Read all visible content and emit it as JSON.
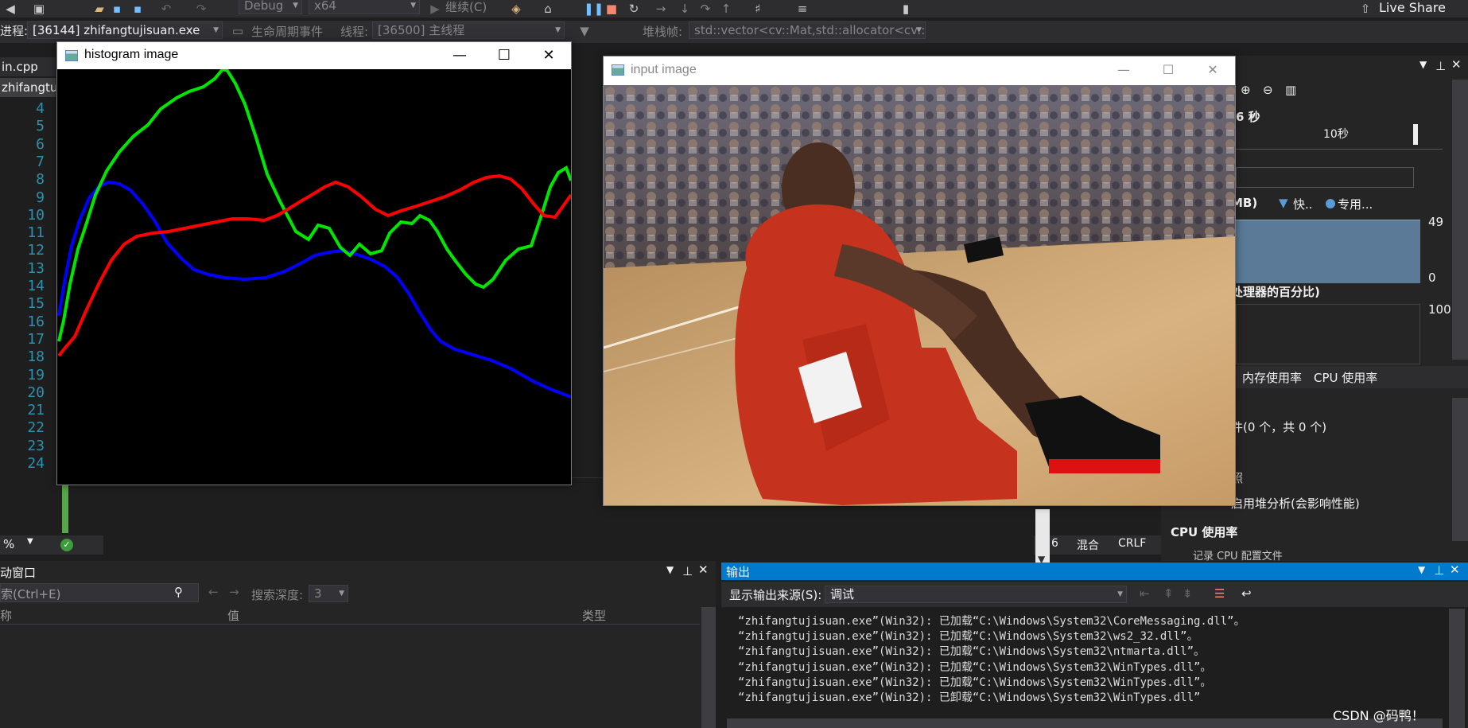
{
  "toolbar": {
    "config": "Debug",
    "platform": "x64",
    "continue_label": "继续(C)",
    "live_share": "Live Share"
  },
  "debugbar": {
    "process_label": "进程:",
    "process": "[36144] zhifangtujisuan.exe",
    "lifecycle_label": "生命周期事件",
    "thread_label": "线程:",
    "thread": "[36500] 主线程",
    "stackframe_label": "堆栈帧:",
    "stackframe": "std::vector<cv::Mat,std::allocator<cv::"
  },
  "editor": {
    "tab1": "in.cpp",
    "tab2": "zhifangtuj",
    "line_numbers": [
      "4",
      "5",
      "6",
      "7",
      "8",
      "9",
      "10",
      "11",
      "12",
      "13",
      "14",
      "15",
      "16",
      "17",
      "18",
      "19",
      "20",
      "21",
      "22",
      "23",
      "24"
    ],
    "zoom": "%"
  },
  "histogram_window": {
    "title": "histogram image"
  },
  "input_window": {
    "title": "input image"
  },
  "diag": {
    "seconds_label": "6 秒",
    "ten_sec": "10秒",
    "mem_label": "MB)",
    "snapshot": "快..",
    "private": "专用...",
    "mem_max": "49",
    "mem_min": "0",
    "cpu_label": "处理器的百分比)",
    "cpu_max": "100",
    "tab_mem": "内存使用率",
    "tab_cpu": "CPU 使用率",
    "events": "件(0 个，共 0 个)",
    "snapshot_hint": "照",
    "enable_profiling": "启用堆分析(会影响性能)",
    "cpu_section": "CPU 使用率",
    "record_cpu": "记录 CPU 配置文件",
    "mixed": "混合",
    "crlf": "CRLF",
    "col6": "6"
  },
  "locals": {
    "title": "动窗口",
    "search_placeholder": "索(Ctrl+E)",
    "search_depth_label": "搜索深度:",
    "search_depth": "3",
    "col_name": "称",
    "col_value": "值",
    "col_type": "类型"
  },
  "output": {
    "title": "输出",
    "source_label": "显示输出来源(S):",
    "source": "调试",
    "lines": [
      "“zhifangtujisuan.exe”(Win32): 已加载“C:\\Windows\\System32\\CoreMessaging.dll”。",
      "“zhifangtujisuan.exe”(Win32): 已加载“C:\\Windows\\System32\\ws2_32.dll”。",
      "“zhifangtujisuan.exe”(Win32): 已加载“C:\\Windows\\System32\\ntmarta.dll”。",
      "“zhifangtujisuan.exe”(Win32): 已加载“C:\\Windows\\System32\\WinTypes.dll”。",
      "“zhifangtujisuan.exe”(Win32): 已加载“C:\\Windows\\System32\\WinTypes.dll”。",
      "“zhifangtujisuan.exe”(Win32): 已卸载“C:\\Windows\\System32\\WinTypes.dll”"
    ],
    "watermark": "CSDN @码鸭！"
  },
  "colors": {
    "vs_blue": "#007acc",
    "hist_green": "#00e600",
    "hist_blue": "#0000ff",
    "hist_red": "#ff0000"
  }
}
